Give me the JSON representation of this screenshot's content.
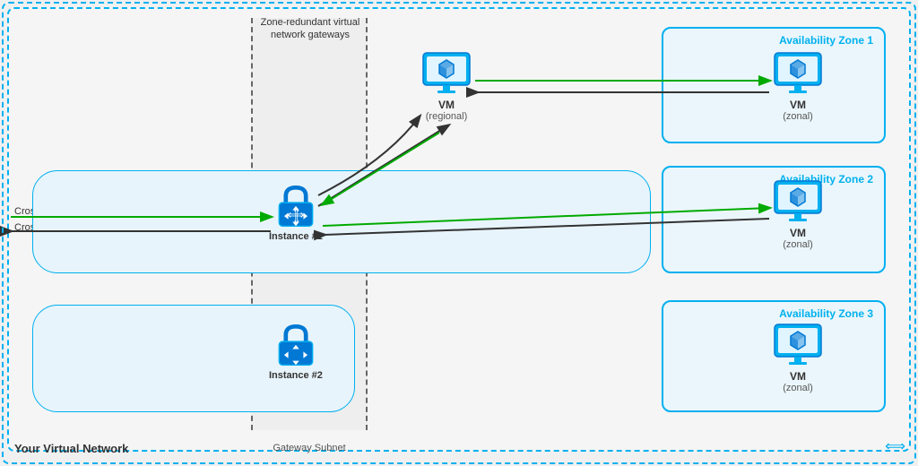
{
  "diagram": {
    "title": "Your Virtual Network",
    "gateway_subnet_label": "Gateway Subnet",
    "zone_redundant_label": "Zone-redundant virtual network gateways",
    "ingress_label": "Cross-Premises Ingress traffic",
    "egress_label": "Cross-Premises Egress traffic",
    "availability_zones": [
      {
        "id": "az1",
        "label": "Availability Zone 1"
      },
      {
        "id": "az2",
        "label": "Availability Zone 2"
      },
      {
        "id": "az3",
        "label": "Availability Zone 3"
      }
    ],
    "instances": [
      {
        "id": "inst1",
        "label": "Instance #1"
      },
      {
        "id": "inst2",
        "label": "Instance #2"
      }
    ],
    "vms": [
      {
        "id": "vm-regional",
        "label": "VM",
        "sublabel": "(regional)"
      },
      {
        "id": "vm-az1",
        "label": "VM",
        "sublabel": "(zonal)"
      },
      {
        "id": "vm-az2",
        "label": "VM",
        "sublabel": "(zonal)"
      },
      {
        "id": "vm-az3",
        "label": "VM",
        "sublabel": "(zonal)"
      }
    ],
    "colors": {
      "blue": "#00b0f0",
      "dark_blue": "#0078d4",
      "green_arrow": "#00aa00",
      "dark_arrow": "#333333"
    }
  }
}
